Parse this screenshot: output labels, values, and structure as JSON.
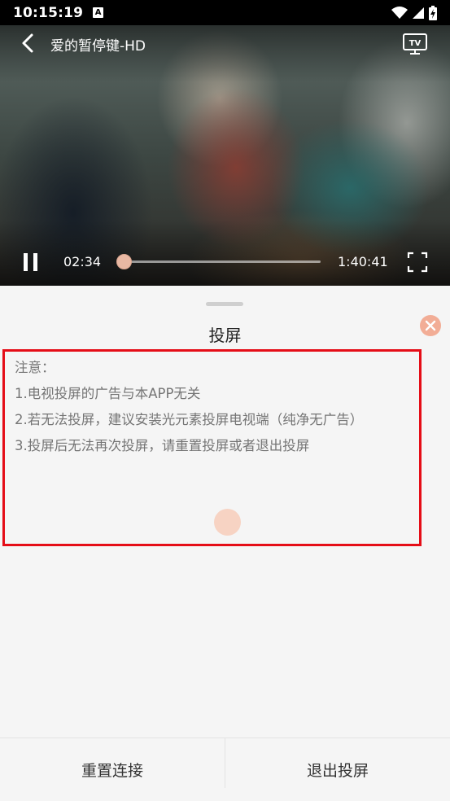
{
  "status_bar": {
    "time": "10:15:19",
    "notification_icon": "A",
    "icons": [
      "wifi-icon",
      "cell-signal-icon",
      "battery-charging-icon"
    ]
  },
  "player": {
    "title": "爱的暂停键-HD",
    "current_time": "02:34",
    "duration": "1:40:41",
    "progress_fraction": 0.025,
    "accent_color": "#e9b8a3",
    "icons": [
      "back-icon",
      "tv-cast-icon",
      "pause-icon",
      "fullscreen-icon"
    ]
  },
  "sheet": {
    "title": "投屏",
    "notice": {
      "heading": "注意：",
      "items": [
        "1.电视投屏的广告与本APP无关",
        "2.若无法投屏，建议安装光元素投屏电视端（纯净无广告）",
        "3.投屏后无法再次投屏，请重置投屏或者退出投屏"
      ],
      "highlight_color": "#e50d17"
    },
    "close_color": "#f2ad96",
    "footer": {
      "reset_label": "重置连接",
      "exit_label": "退出投屏"
    }
  }
}
